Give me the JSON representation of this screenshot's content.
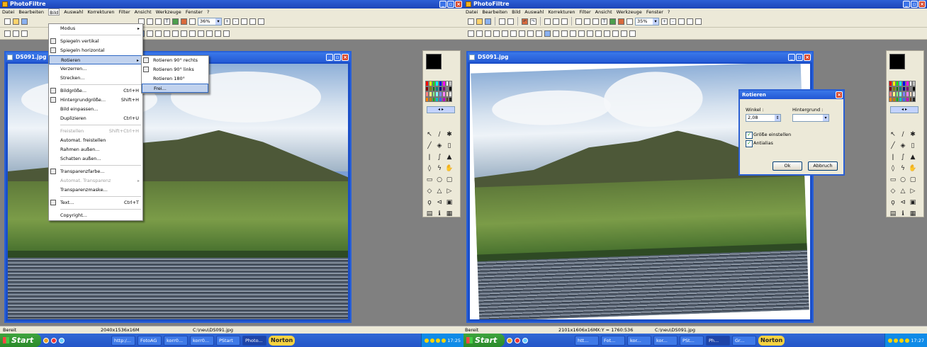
{
  "app_title": "PhotoFiltre",
  "menus": [
    "Datei",
    "Bearbeiten",
    "Bild",
    "Auswahl",
    "Korrekturen",
    "Filter",
    "Ansicht",
    "Werkzeuge",
    "Fenster",
    "?"
  ],
  "zoom_left": "36%",
  "zoom_right": "35%",
  "doc_title": "DS091.jpg",
  "bild_menu": [
    {
      "label": "Modus",
      "arrow": "▸",
      "icon": ""
    },
    {
      "sep": true
    },
    {
      "label": "Spiegeln vertikal",
      "icon": "flip-vertical-icon"
    },
    {
      "label": "Spiegeln horizontal",
      "icon": "flip-horizontal-icon"
    },
    {
      "label": "Rotieren",
      "arrow": "▸",
      "highlight": true
    },
    {
      "label": "Verzerren..."
    },
    {
      "label": "Strecken..."
    },
    {
      "sep": true
    },
    {
      "label": "Bildgröße...",
      "shortcut": "Ctrl+H",
      "icon": "image-size-icon"
    },
    {
      "label": "Hintergrundgröße...",
      "shortcut": "Shift+H",
      "icon": "canvas-size-icon"
    },
    {
      "label": "Bild einpassen..."
    },
    {
      "label": "Duplizieren",
      "shortcut": "Ctrl+U"
    },
    {
      "sep": true
    },
    {
      "label": "Freistellen",
      "shortcut": "Shift+Ctrl+H",
      "disabled": true
    },
    {
      "label": "Automat. freistellen"
    },
    {
      "label": "Rahmen außen..."
    },
    {
      "label": "Schatten außen..."
    },
    {
      "sep": true
    },
    {
      "label": "Transparenzfarbe...",
      "icon": "transparency-icon"
    },
    {
      "label": "Automat. Transparenz",
      "arrow": "▸",
      "disabled": true
    },
    {
      "label": "Transparenzmaske..."
    },
    {
      "sep": true
    },
    {
      "label": "Text...",
      "shortcut": "Ctrl+T",
      "icon": "text-icon"
    },
    {
      "sep": true
    },
    {
      "label": "Copyright..."
    }
  ],
  "rotate_submenu": [
    {
      "label": "Rotieren 90° rechts",
      "icon": "rotate-right-icon"
    },
    {
      "label": "Rotieren 90° links",
      "icon": "rotate-left-icon"
    },
    {
      "label": "Rotieren 180°"
    },
    {
      "label": "Frei...",
      "highlight": true
    }
  ],
  "dialog": {
    "title": "Rotieren",
    "winkel_label": "Winkel :",
    "winkel_value": "2,08",
    "hintergrund_label": "Hintergrund :",
    "chk_size": "Größe einstellen",
    "chk_antialias": "Antialias",
    "ok": "Ok",
    "cancel": "Abbruch"
  },
  "status_left": {
    "ready": "Bereit",
    "size": "2040x1536x16M",
    "path": "C:\\neu\\DS091.jpg"
  },
  "status_right": {
    "ready": "Bereit",
    "size": "2101x1606x16M",
    "coords": "X:Y = 1760:536",
    "path": "C:\\neu\\DS091.jpg"
  },
  "taskbar_left": {
    "start": "Start",
    "tasks": [
      "http:/...",
      "FotoAG",
      "korr0...",
      "korr0...",
      "PStart",
      "Photo..."
    ],
    "norton": "Norton",
    "clock": "17:25"
  },
  "taskbar_right": {
    "start": "Start",
    "tasks": [
      "htt...",
      "Fot...",
      "kor...",
      "kor...",
      "PSt...",
      "Ph...",
      "Gr..."
    ],
    "norton": "Norton",
    "clock": "17:27"
  },
  "swatch_colors": [
    "#ff0000",
    "#ffff00",
    "#00ff00",
    "#00ffff",
    "#0000ff",
    "#ff00ff",
    "#ffffff",
    "#c0c0c0",
    "#800000",
    "#808000",
    "#008000",
    "#008080",
    "#000080",
    "#800080",
    "#808080",
    "#000000",
    "#ff8080",
    "#ffff80",
    "#80ff80",
    "#80ffff",
    "#8080ff",
    "#ff80ff",
    "#ffe0c0",
    "#e0e0e0",
    "#ff8000",
    "#c08000",
    "#00c000",
    "#00c0c0",
    "#4060ff",
    "#c000c0",
    "#604020",
    "#202020"
  ]
}
